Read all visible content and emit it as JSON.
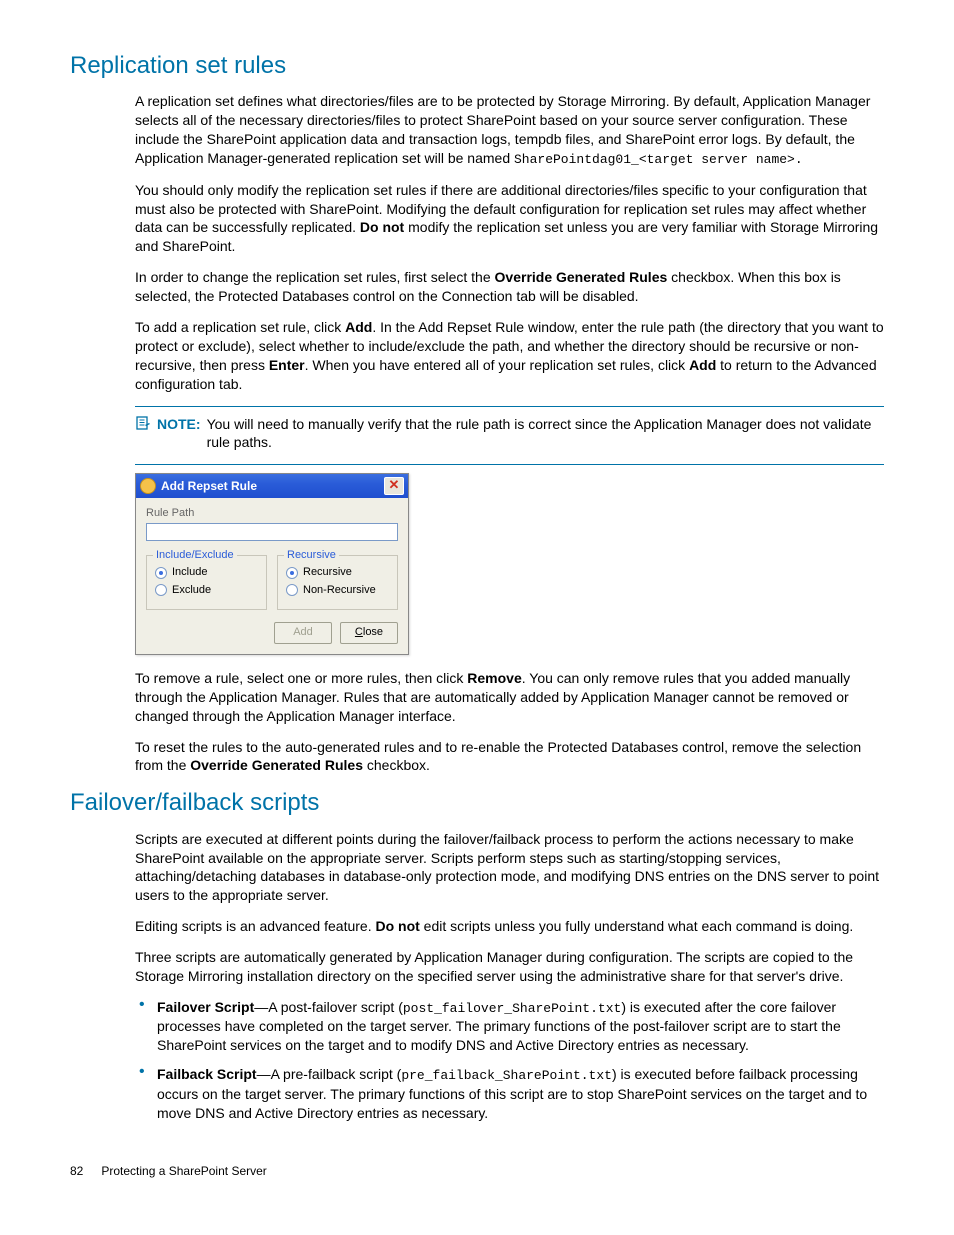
{
  "h1": "Replication set rules",
  "p1a": "A replication set defines what directories/files are to be protected by Storage Mirroring. By default, Application Manager selects all of the necessary directories/files to protect SharePoint based on your source server configuration. These include the SharePoint application data and transaction logs, tempdb files, and SharePoint error logs. By default, the Application Manager-generated replication set will be named ",
  "p1b": "SharePointdag01_<target server name>.",
  "p2a": "You should only modify the replication set rules if there are additional directories/files specific to your configuration that must also be protected with SharePoint. Modifying the default configuration for replication set rules may affect whether data can be successfully replicated. ",
  "p2b": "Do not",
  "p2c": " modify the replication set unless you are very familiar with Storage Mirroring and SharePoint.",
  "p3a": "In order to change the replication set rules, first select the ",
  "p3b": "Override Generated Rules",
  "p3c": " checkbox. When this box is selected, the Protected Databases control on the Connection tab will be disabled.",
  "p4a": "To add a replication set rule, click ",
  "p4b": "Add",
  "p4c": ". In the Add Repset Rule window, enter the rule path (the directory that you want to protect or exclude), select whether to include/exclude the path, and whether the directory should be recursive or non-recursive, then press ",
  "p4d": "Enter",
  "p4e": ". When you have entered all of your replication set rules, click ",
  "p4f": "Add",
  "p4g": " to return to the Advanced configuration tab.",
  "note_label": "NOTE:",
  "note_text": "You will need to manually verify that the rule path is correct since the Application Manager does not validate rule paths.",
  "dialog": {
    "title": "Add Repset Rule",
    "rule_path": "Rule Path",
    "grp1": "Include/Exclude",
    "opt_include": "Include",
    "opt_exclude": "Exclude",
    "grp2": "Recursive",
    "opt_recursive": "Recursive",
    "opt_nonrecursive": "Non-Recursive",
    "btn_add": "Add",
    "btn_close_u": "C",
    "btn_close_rest": "lose"
  },
  "p5a": "To remove a rule, select one or more rules, then click ",
  "p5b": "Remove",
  "p5c": ". You can only remove rules that you added manually through the Application Manager. Rules that are automatically added by Application Manager cannot be removed or changed through the Application Manager interface.",
  "p6a": "To reset the rules to the auto-generated rules and to re-enable the Protected Databases control, remove the selection from the ",
  "p6b": "Override Generated Rules",
  "p6c": " checkbox.",
  "h2": "Failover/failback scripts",
  "p7": "Scripts are executed at different points during the failover/failback process to perform the actions necessary to make SharePoint available on the appropriate server. Scripts perform steps such as starting/stopping services, attaching/detaching databases in database-only protection mode, and modifying DNS entries on the DNS server to point users to the appropriate server.",
  "p8a": "Editing scripts is an advanced feature. ",
  "p8b": "Do not",
  "p8c": " edit scripts unless you fully understand what each command is doing.",
  "p9": "Three scripts are automatically generated by Application Manager during configuration. The scripts are copied to the Storage Mirroring installation directory on the specified server using the administrative share for that server's drive.",
  "li1a": "Failover Script",
  "li1b": "—A post-failover script (",
  "li1c": "post_failover_SharePoint.txt",
  "li1d": ") is executed after the core failover processes have completed on the target server. The primary functions of the post-failover script are to start the SharePoint services on the target and to modify DNS and Active Directory entries as necessary.",
  "li2a": "Failback Script",
  "li2b": "—A pre-failback script (",
  "li2c": "pre_failback_SharePoint.txt",
  "li2d": ") is executed before failback processing occurs on the target server. The primary functions of this script are to stop SharePoint services on the target and to move DNS and Active Directory entries as necessary.",
  "footer_page": "82",
  "footer_title": "Protecting a SharePoint Server"
}
